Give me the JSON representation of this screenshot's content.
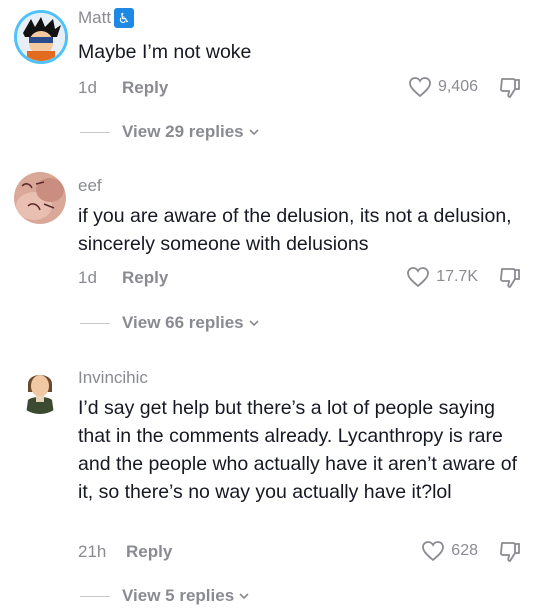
{
  "comments": [
    {
      "username": "Matt",
      "badge": "♿",
      "text": "Maybe I’m not woke",
      "age": "1d",
      "reply_label": "Reply",
      "likes": "9,406",
      "view_replies": "View 29 replies"
    },
    {
      "username": "eef",
      "text": "if you are aware of the delusion, its not a delusion, sincerely someone with delusions",
      "age": "1d",
      "reply_label": "Reply",
      "likes": "17.7K",
      "view_replies": "View 66 replies"
    },
    {
      "username": "Invincihic",
      "text": "I’d say get help but there’s a lot of people saying that in the comments already. Lycanthropy is rare and the people who actually have it aren’t aware of it, so there’s no way you actually have it?lol",
      "age": "21h",
      "reply_label": "Reply",
      "likes": "628",
      "view_replies": "View 5 replies"
    }
  ],
  "colors": {
    "muted": "#8a8b91",
    "text": "#161823",
    "badge_bg": "#1e88e5",
    "avatar_ring": "#4fc3f7"
  },
  "icons": [
    "heart-outline-icon",
    "thumbs-down-icon",
    "chevron-down-icon",
    "wheelchair-badge-icon"
  ]
}
